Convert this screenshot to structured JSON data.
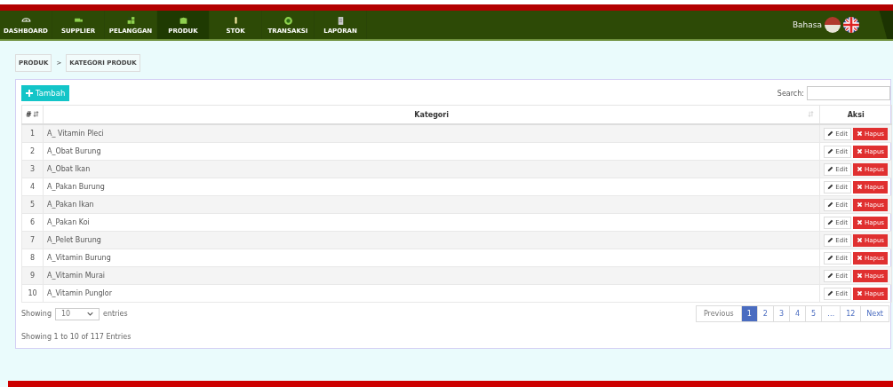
{
  "nav": {
    "items": [
      {
        "label": "DASHBOARD",
        "selected": false
      },
      {
        "label": "SUPPLIER",
        "selected": false
      },
      {
        "label": "PELANGGAN",
        "selected": false
      },
      {
        "label": "PRODUK",
        "selected": true
      },
      {
        "label": "STOK",
        "selected": false
      },
      {
        "label": "TRANSAKSI",
        "selected": false
      },
      {
        "label": "LAPORAN",
        "selected": false
      }
    ],
    "language_label": "Bahasa"
  },
  "breadcrumb": [
    "PRODUK",
    ">",
    "KATEGORI PRODUK"
  ],
  "add_button": "Tambah",
  "search": {
    "label": "Search:"
  },
  "table": {
    "columns": [
      "#",
      "Kategori",
      "Aksi"
    ],
    "rows": [
      {
        "no": "1",
        "kategori": "A_ Vitamin Pleci",
        "edit": "Edit",
        "delete": "Hapus"
      },
      {
        "no": "2",
        "kategori": "A_Obat Burung",
        "edit": "Edit",
        "delete": "Hapus"
      },
      {
        "no": "3",
        "kategori": "A_Obat Ikan",
        "edit": "Edit",
        "delete": "Hapus"
      },
      {
        "no": "4",
        "kategori": "A_Pakan Burung",
        "edit": "Edit",
        "delete": "Hapus"
      },
      {
        "no": "5",
        "kategori": "A_Pakan Ikan",
        "edit": "Edit",
        "delete": "Hapus"
      },
      {
        "no": "6",
        "kategori": "A_Pakan Koi",
        "edit": "Edit",
        "delete": "Hapus"
      },
      {
        "no": "7",
        "kategori": "A_Pelet Burung",
        "edit": "Edit",
        "delete": "Hapus"
      },
      {
        "no": "8",
        "kategori": "A_Vitamin Burung",
        "edit": "Edit",
        "delete": "Hapus"
      },
      {
        "no": "9",
        "kategori": "A_Vitamin Murai",
        "edit": "Edit",
        "delete": "Hapus"
      },
      {
        "no": "10",
        "kategori": "A_Vitamin Punglor",
        "edit": "Edit",
        "delete": "Hapus"
      }
    ]
  },
  "length": {
    "before": "Showing",
    "value": "10",
    "after": "entries"
  },
  "info": "Showing 1 to 10 of 117 Entries",
  "pagination": [
    {
      "label": "Previous",
      "selected": false
    },
    {
      "label": "1",
      "selected": true
    },
    {
      "label": "2",
      "selected": false
    },
    {
      "label": "3",
      "selected": false
    },
    {
      "label": "4",
      "selected": false
    },
    {
      "label": "5",
      "selected": false
    },
    {
      "label": "…",
      "selected": false
    },
    {
      "label": "12",
      "selected": false
    },
    {
      "label": "Next",
      "selected": false
    }
  ]
}
